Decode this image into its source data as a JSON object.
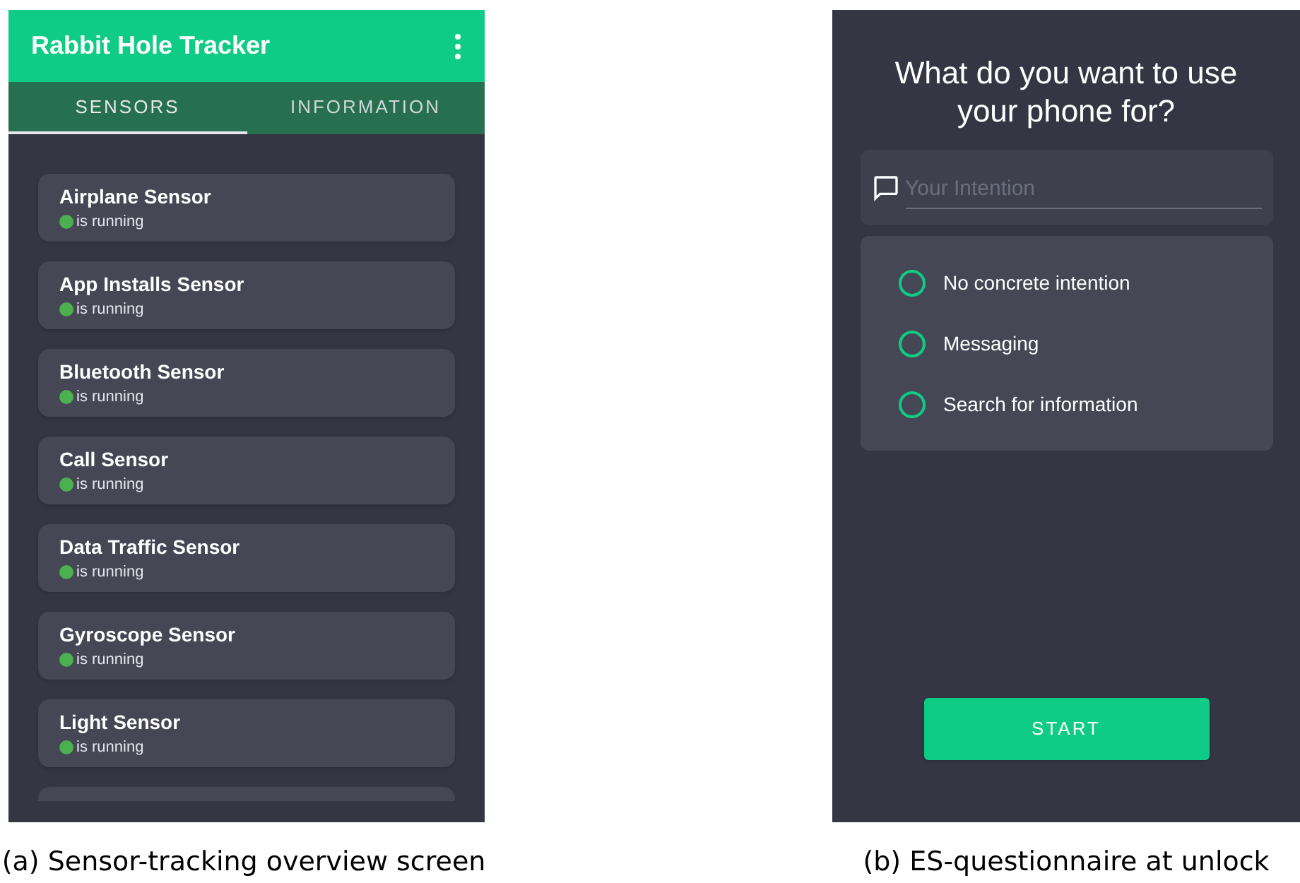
{
  "panels": [
    {
      "app_bar": {
        "title": "Rabbit Hole Tracker"
      },
      "tabs": [
        {
          "label": "SENSORS",
          "selected": true
        },
        {
          "label": "INFORMATION",
          "selected": false
        }
      ],
      "sensors": [
        {
          "name": "Airplane Sensor",
          "status": "is running",
          "running": true
        },
        {
          "name": "App Installs Sensor",
          "status": "is running",
          "running": true
        },
        {
          "name": "Bluetooth Sensor",
          "status": "is running",
          "running": true
        },
        {
          "name": "Call Sensor",
          "status": "is running",
          "running": true
        },
        {
          "name": "Data Traffic Sensor",
          "status": "is running",
          "running": true
        },
        {
          "name": "Gyroscope Sensor",
          "status": "is running",
          "running": true
        },
        {
          "name": "Light Sensor",
          "status": "is running",
          "running": true
        }
      ],
      "caption": "(a) Sensor-tracking overview screen"
    },
    {
      "question": "What do you want to use your phone for?",
      "intention_field": {
        "placeholder": "Your Intention"
      },
      "options": [
        {
          "label": "No concrete intention",
          "selected": false
        },
        {
          "label": "Messaging",
          "selected": false
        },
        {
          "label": "Search for information",
          "selected": false
        }
      ],
      "start_button": "START",
      "caption": "(b) ES-questionnaire at unlock"
    }
  ]
}
